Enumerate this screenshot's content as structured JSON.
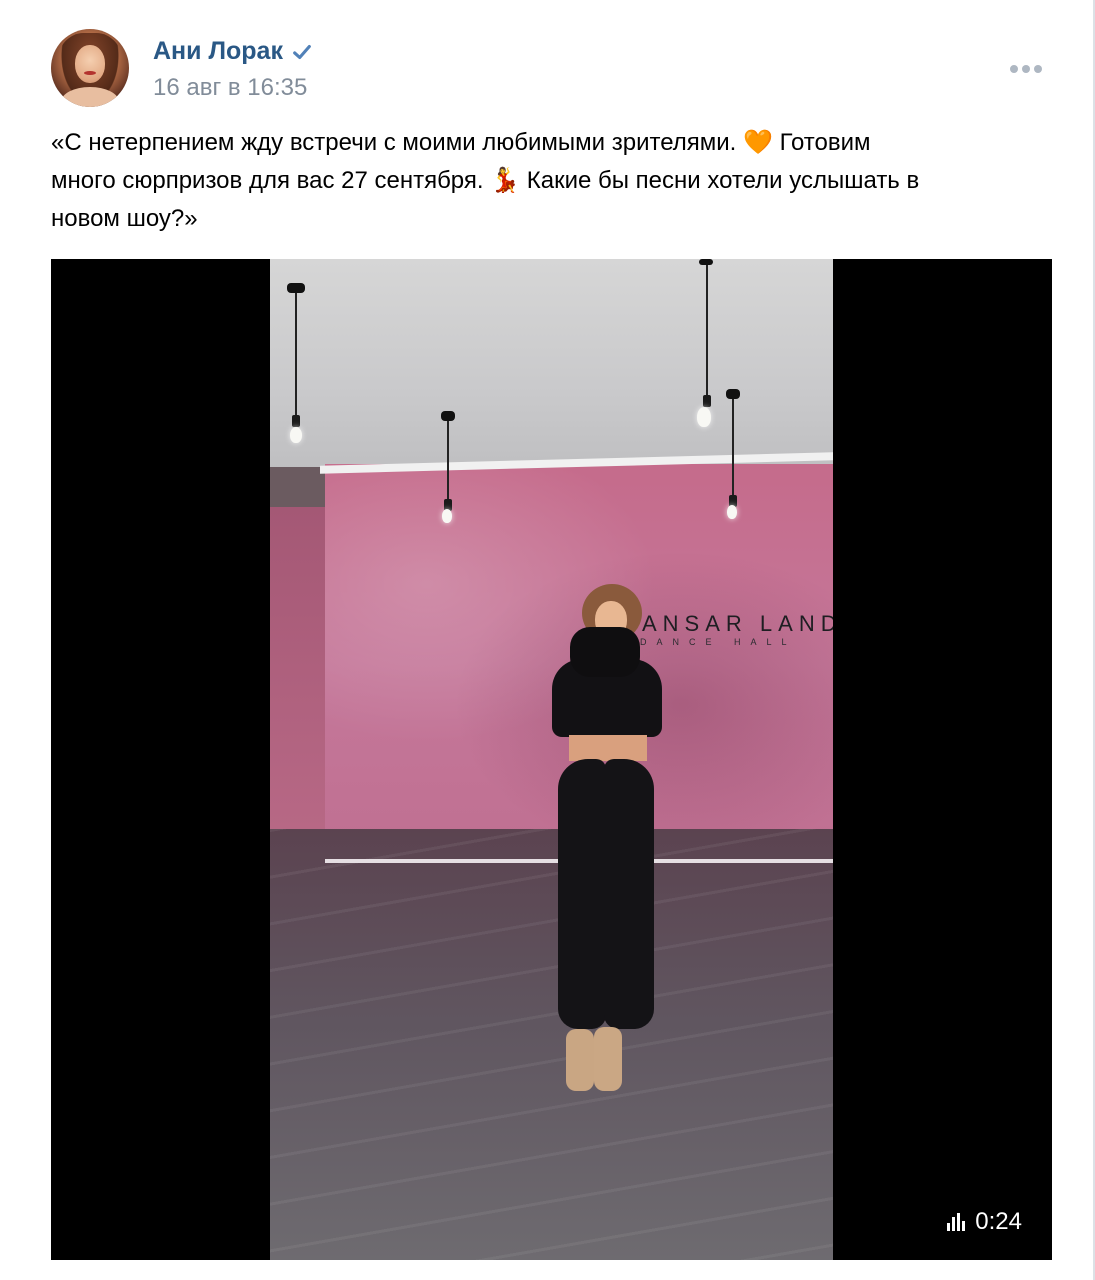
{
  "post": {
    "author": "Ани Лорак",
    "date": "16 авг в 16:35",
    "text": "«С нетерпением жду встречи с моими любимыми зрителями. ❤ Готовим много сюрпризов для вас 27 сентября. 💃 Какие бы песни хотели услышать в новом шоу?»",
    "text_lines": [
      "«С нетерпением жду встречи с моими любимыми зрителями. 🧡 Готовим",
      "много сюрпризов для вас 27 сентября. 💃 Какие бы песни хотели услышать в",
      "новом шоу?»"
    ]
  },
  "video": {
    "duration": "0:24",
    "studio_sign": "ANSAR LAND",
    "studio_sub": "DANCE HALL"
  },
  "icons": {
    "verified": "verified-check-icon",
    "more": "more-dots-icon",
    "equalizer": "equalizer-icon"
  },
  "colors": {
    "author_link": "#2a5885",
    "date_gray": "#818c99",
    "background": "#edeef0",
    "verified_blue": "#5181b8"
  }
}
